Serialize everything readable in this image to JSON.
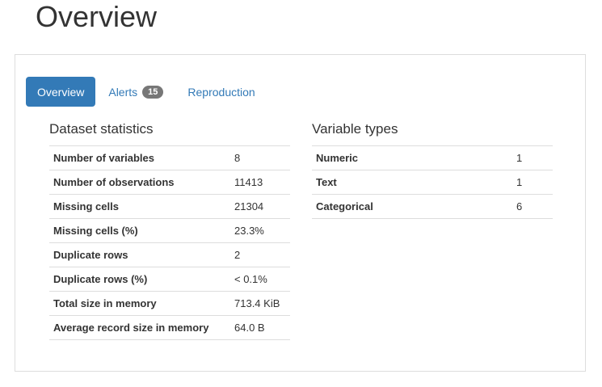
{
  "page_title": "Overview",
  "tabs": [
    {
      "label": "Overview",
      "active": true
    },
    {
      "label": "Alerts",
      "badge": "15"
    },
    {
      "label": "Reproduction"
    }
  ],
  "dataset_statistics": {
    "title": "Dataset statistics",
    "rows": [
      {
        "label": "Number of variables",
        "value": "8"
      },
      {
        "label": "Number of observations",
        "value": "11413"
      },
      {
        "label": "Missing cells",
        "value": "21304"
      },
      {
        "label": "Missing cells (%)",
        "value": "23.3%"
      },
      {
        "label": "Duplicate rows",
        "value": "2"
      },
      {
        "label": "Duplicate rows (%)",
        "value": "< 0.1%"
      },
      {
        "label": "Total size in memory",
        "value": "713.4 KiB"
      },
      {
        "label": "Average record size in memory",
        "value": "64.0 B"
      }
    ]
  },
  "variable_types": {
    "title": "Variable types",
    "rows": [
      {
        "label": "Numeric",
        "value": "1"
      },
      {
        "label": "Text",
        "value": "1"
      },
      {
        "label": "Categorical",
        "value": "6"
      }
    ]
  },
  "colors": {
    "accent": "#337ab7",
    "badge": "#777777",
    "border": "#dddddd"
  }
}
